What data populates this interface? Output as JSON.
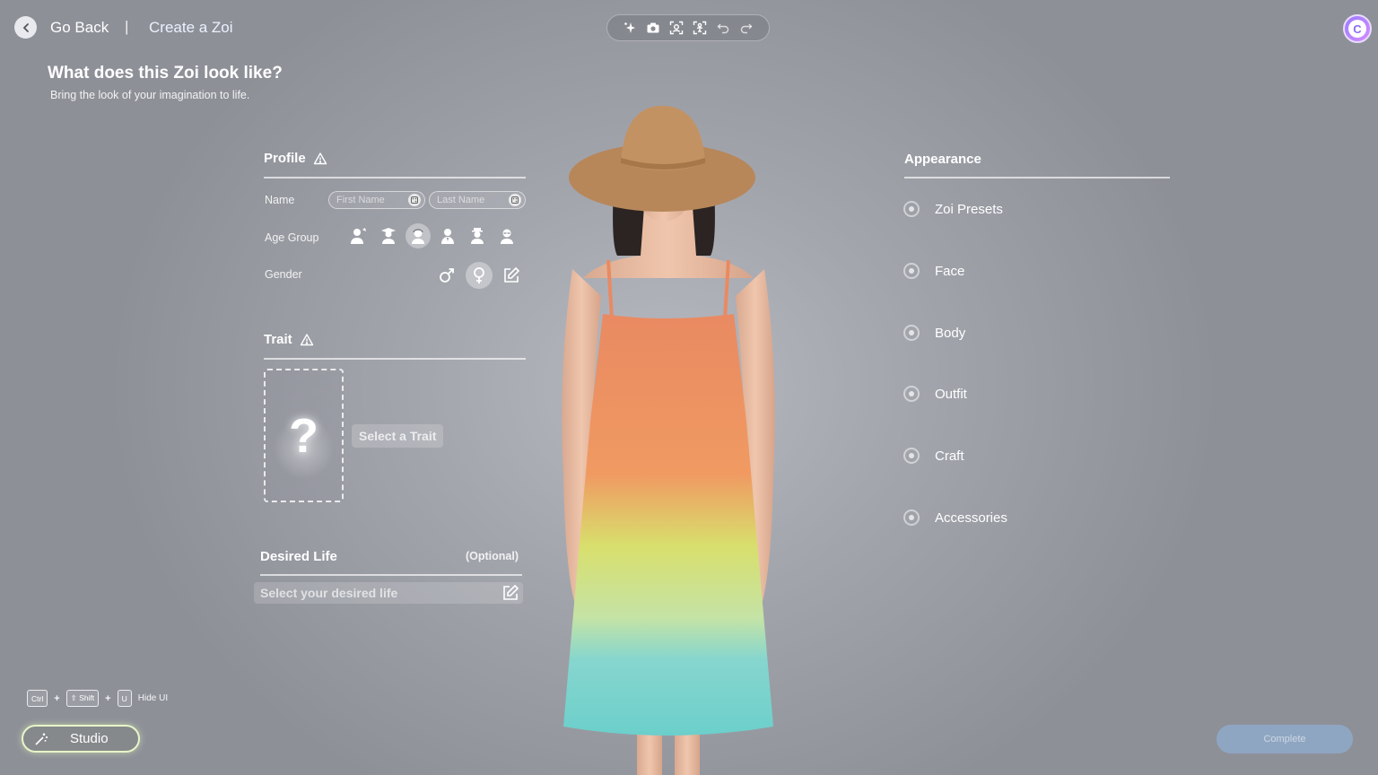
{
  "nav": {
    "go_back": "Go Back",
    "separator": "|",
    "crumb": "Create a Zoi"
  },
  "page": {
    "title": "What does this Zoi look like?",
    "subtitle": "Bring the look of your imagination to life."
  },
  "toolbar": {
    "icons": [
      "sparkle-icon",
      "camera-icon",
      "face-focus-icon",
      "body-focus-icon",
      "undo-icon",
      "redo-icon"
    ]
  },
  "profile": {
    "title": "Profile",
    "name_label": "Name",
    "first_name_placeholder": "First Name",
    "last_name_placeholder": "Last Name",
    "age_label": "Age Group",
    "age_groups": [
      "infant",
      "child",
      "teen",
      "adult",
      "senior-adult",
      "elder"
    ],
    "age_selected": "teen",
    "gender_label": "Gender",
    "gender_selected": "female"
  },
  "trait": {
    "title": "Trait",
    "card_symbol": "?",
    "select_label": "Select a Trait"
  },
  "desired_life": {
    "title": "Desired Life",
    "optional": "(Optional)",
    "placeholder": "Select your desired life"
  },
  "appearance": {
    "title": "Appearance",
    "items": [
      "Zoi Presets",
      "Face",
      "Body",
      "Outfit",
      "Craft",
      "Accessories"
    ]
  },
  "hotkeys": {
    "keys": [
      "Ctrl",
      "⇧ Shift",
      "U"
    ],
    "plus": "+",
    "label": "Hide UI"
  },
  "studio": {
    "label": "Studio"
  },
  "complete": {
    "label": "Complete"
  },
  "colors": {
    "accent": "#8fa6c2",
    "studio_glow": "#e6f5c8",
    "account": "#9b7bff"
  }
}
